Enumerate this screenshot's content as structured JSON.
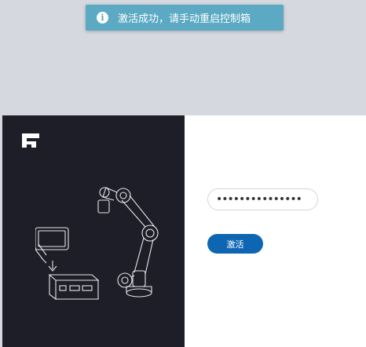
{
  "toast": {
    "icon": "info-icon",
    "icon_glyph": "i",
    "message": "激活成功，请手动重启控制箱"
  },
  "left_panel": {
    "logo_icon": "brand-logo-icon",
    "illustration": "robot-arm-controller-illustration"
  },
  "form": {
    "password_value": "•••••••••••••••",
    "activate_label": "激活"
  },
  "colors": {
    "toast_bg": "#5ba9c3",
    "left_bg": "#1d1e28",
    "button_bg": "#0e66b3",
    "page_bg": "#d6d8df"
  }
}
